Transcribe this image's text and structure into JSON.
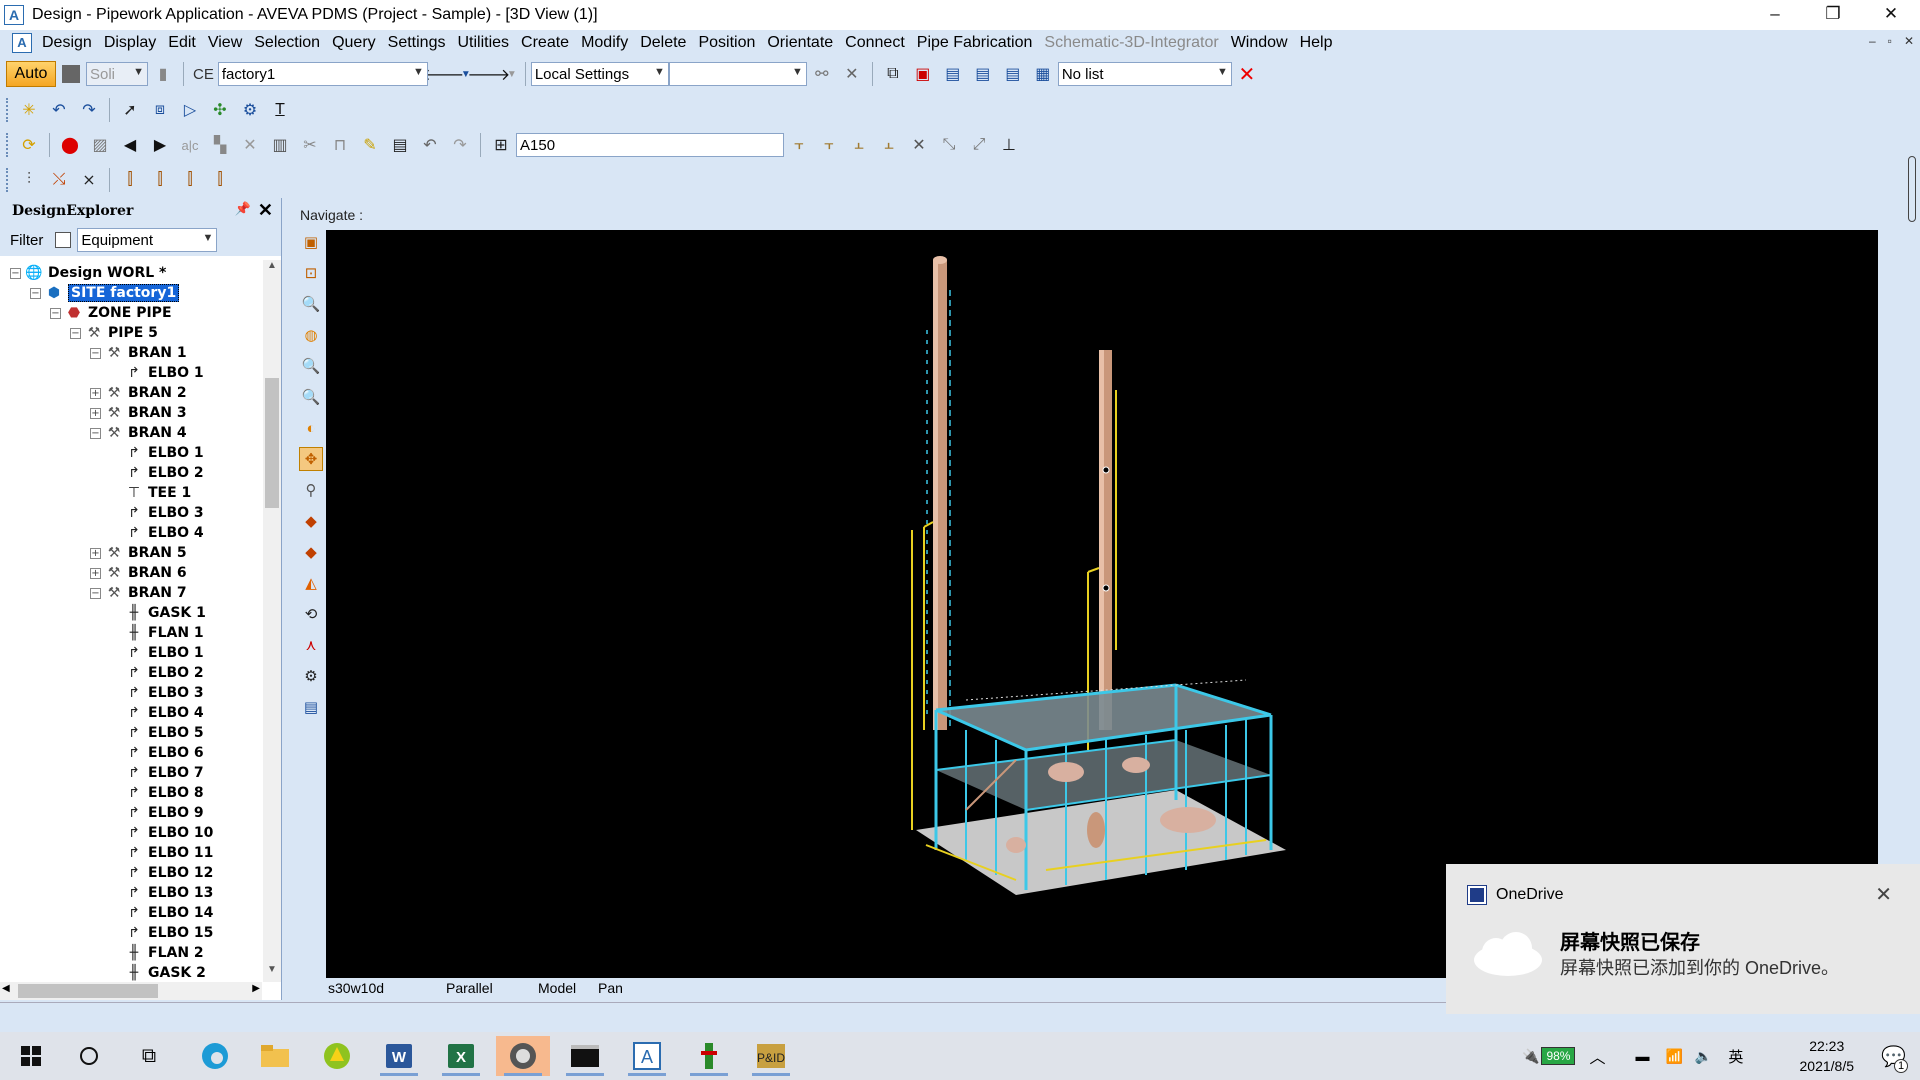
{
  "window": {
    "title": "Design - Pipework Application - AVEVA PDMS (Project - Sample) - [3D View (1)]",
    "app_icon": "A",
    "controls": [
      "–",
      "❐",
      "✕"
    ]
  },
  "menu": {
    "items": [
      "Design",
      "Display",
      "Edit",
      "View",
      "Selection",
      "Query",
      "Settings",
      "Utilities",
      "Create",
      "Modify",
      "Delete",
      "Position",
      "Orientate",
      "Connect",
      "Pipe Fabrication",
      "Schematic-3D-Integrator",
      "Window",
      "Help"
    ],
    "disabled": [
      "Schematic-3D-Integrator"
    ],
    "mdi_controls": [
      "–",
      "▫",
      "✕"
    ]
  },
  "toolbar1": {
    "auto_label": "Auto",
    "solid_value": "Soli",
    "ce_label": "CE",
    "ce_value": "factory1",
    "settings_value": "Local Settings",
    "empty_combo": "",
    "list_value": "No list"
  },
  "toolbar3": {
    "spec_value": "A150"
  },
  "explorer": {
    "title": "DesignExplorer",
    "filter_label": "Filter",
    "filter_value": "Equipment",
    "tree": [
      {
        "label": "Design WORL *",
        "level": 0,
        "toggle": "−",
        "icon": "globe"
      },
      {
        "label": "SITE factory1",
        "level": 1,
        "toggle": "−",
        "icon": "site",
        "selected": true
      },
      {
        "label": "ZONE PIPE",
        "level": 2,
        "toggle": "−",
        "icon": "zone"
      },
      {
        "label": "PIPE 5",
        "level": 3,
        "toggle": "−",
        "icon": "pipe"
      },
      {
        "label": "BRAN 1",
        "level": 4,
        "toggle": "−",
        "icon": "bran"
      },
      {
        "label": "ELBO 1",
        "level": 5,
        "toggle": "",
        "icon": "elbo"
      },
      {
        "label": "BRAN 2",
        "level": 4,
        "toggle": "+",
        "icon": "bran"
      },
      {
        "label": "BRAN 3",
        "level": 4,
        "toggle": "+",
        "icon": "bran"
      },
      {
        "label": "BRAN 4",
        "level": 4,
        "toggle": "−",
        "icon": "bran"
      },
      {
        "label": "ELBO 1",
        "level": 5,
        "toggle": "",
        "icon": "elbo"
      },
      {
        "label": "ELBO 2",
        "level": 5,
        "toggle": "",
        "icon": "elbo"
      },
      {
        "label": "TEE 1",
        "level": 5,
        "toggle": "",
        "icon": "tee"
      },
      {
        "label": "ELBO 3",
        "level": 5,
        "toggle": "",
        "icon": "elbo"
      },
      {
        "label": "ELBO 4",
        "level": 5,
        "toggle": "",
        "icon": "elbo"
      },
      {
        "label": "BRAN 5",
        "level": 4,
        "toggle": "+",
        "icon": "bran"
      },
      {
        "label": "BRAN 6",
        "level": 4,
        "toggle": "+",
        "icon": "bran"
      },
      {
        "label": "BRAN 7",
        "level": 4,
        "toggle": "−",
        "icon": "bran"
      },
      {
        "label": "GASK 1",
        "level": 5,
        "toggle": "",
        "icon": "gask"
      },
      {
        "label": "FLAN 1",
        "level": 5,
        "toggle": "",
        "icon": "gask"
      },
      {
        "label": "ELBO 1",
        "level": 5,
        "toggle": "",
        "icon": "elbo"
      },
      {
        "label": "ELBO 2",
        "level": 5,
        "toggle": "",
        "icon": "elbo"
      },
      {
        "label": "ELBO 3",
        "level": 5,
        "toggle": "",
        "icon": "elbo"
      },
      {
        "label": "ELBO 4",
        "level": 5,
        "toggle": "",
        "icon": "elbo"
      },
      {
        "label": "ELBO 5",
        "level": 5,
        "toggle": "",
        "icon": "elbo"
      },
      {
        "label": "ELBO 6",
        "level": 5,
        "toggle": "",
        "icon": "elbo"
      },
      {
        "label": "ELBO 7",
        "level": 5,
        "toggle": "",
        "icon": "elbo"
      },
      {
        "label": "ELBO 8",
        "level": 5,
        "toggle": "",
        "icon": "elbo"
      },
      {
        "label": "ELBO 9",
        "level": 5,
        "toggle": "",
        "icon": "elbo"
      },
      {
        "label": "ELBO 10",
        "level": 5,
        "toggle": "",
        "icon": "elbo"
      },
      {
        "label": "ELBO 11",
        "level": 5,
        "toggle": "",
        "icon": "elbo"
      },
      {
        "label": "ELBO 12",
        "level": 5,
        "toggle": "",
        "icon": "elbo"
      },
      {
        "label": "ELBO 13",
        "level": 5,
        "toggle": "",
        "icon": "elbo"
      },
      {
        "label": "ELBO 14",
        "level": 5,
        "toggle": "",
        "icon": "elbo"
      },
      {
        "label": "ELBO 15",
        "level": 5,
        "toggle": "",
        "icon": "elbo"
      },
      {
        "label": "FLAN 2",
        "level": 5,
        "toggle": "",
        "icon": "gask"
      },
      {
        "label": "GASK 2",
        "level": 5,
        "toggle": "",
        "icon": "gask"
      }
    ]
  },
  "view": {
    "navigate_label": "Navigate :",
    "status": [
      "s30w10d",
      "Parallel",
      "Model",
      "Pan"
    ],
    "background": "#000000"
  },
  "toast": {
    "app": "OneDrive",
    "title": "屏幕快照已保存",
    "body": "屏幕快照已添加到你的 OneDrive。",
    "close": "✕"
  },
  "taskbar": {
    "battery": "98%",
    "ime": "英",
    "time": "22:23",
    "date": "2021/8/5",
    "notification_count": "1",
    "apps": [
      "start-icon",
      "search-icon",
      "task-view-icon",
      "edge-icon",
      "explorer-icon",
      "app-icon",
      "word-icon",
      "excel-icon",
      "aveva-icon",
      "terminal-icon",
      "aveva-design-icon",
      "tool-icon",
      "pid-icon"
    ]
  },
  "colors": {
    "ui_background": "#d9e6f5",
    "selection": "#1565d8",
    "structure_cyan": "#3cc8e8",
    "column_copper": "#c9977a",
    "pipe_yellow": "#e8d020"
  }
}
